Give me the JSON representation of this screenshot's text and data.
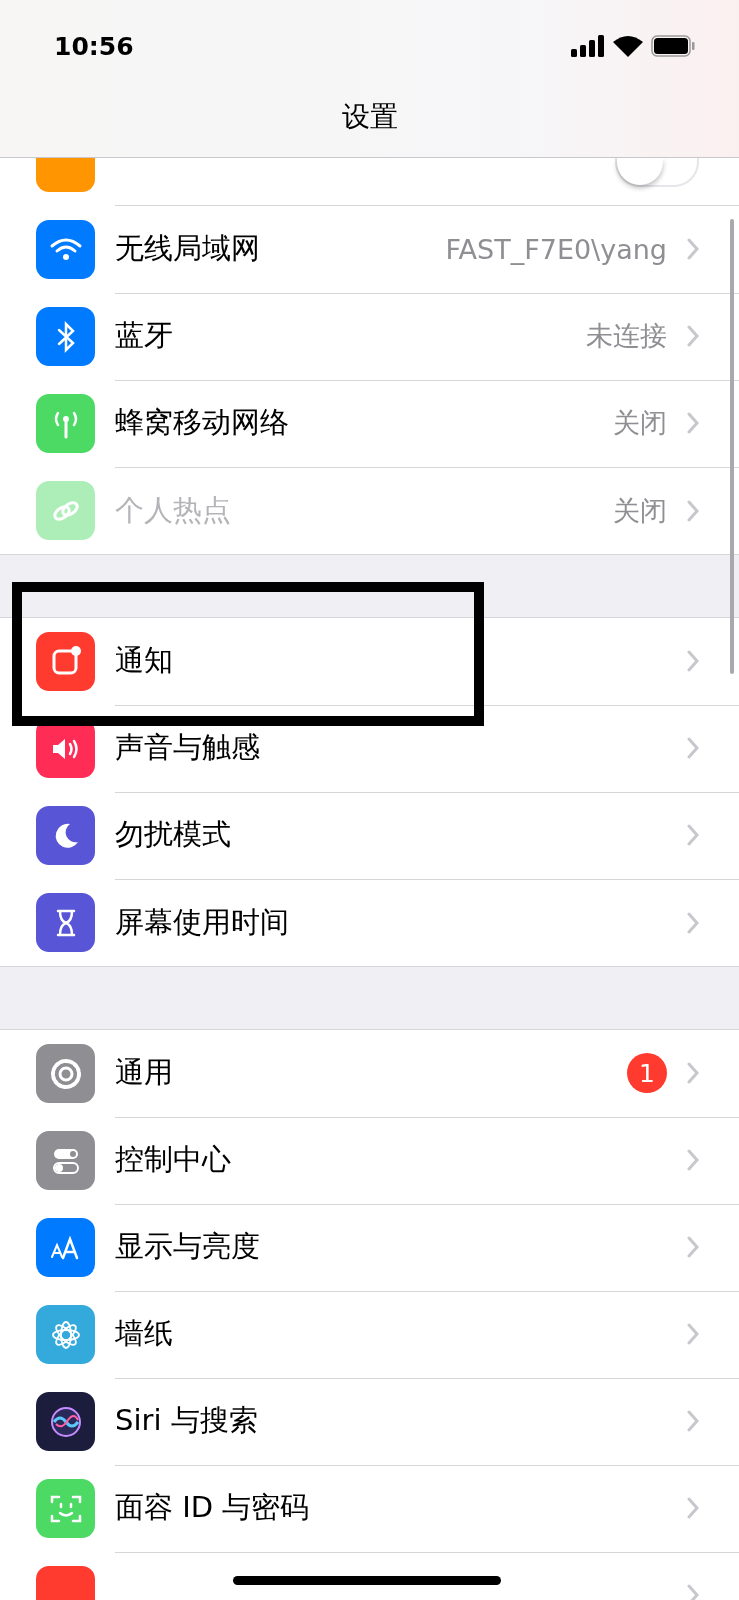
{
  "status_bar": {
    "time": "10:56"
  },
  "nav": {
    "title": "设置"
  },
  "groups": [
    {
      "rows": [
        {
          "kind": "toggle",
          "on": false,
          "disabled": false,
          "clipped_top": true
        },
        {
          "label": "无线局域网",
          "kind": "value",
          "value": "FAST_F7E0\\yang",
          "disabled": false
        },
        {
          "label": "蓝牙",
          "kind": "value",
          "value": "未连接",
          "disabled": false
        },
        {
          "label": "蜂窝移动网络",
          "kind": "value",
          "value": "关闭",
          "disabled": false
        },
        {
          "label": "个人热点",
          "kind": "value",
          "value": "关闭",
          "disabled": true
        }
      ]
    },
    {
      "rows": [
        {
          "label": "通知",
          "kind": "plain",
          "disabled": false,
          "highlighted": true
        },
        {
          "label": "声音与触感",
          "kind": "plain",
          "disabled": false
        },
        {
          "label": "勿扰模式",
          "kind": "plain",
          "disabled": false
        },
        {
          "label": "屏幕使用时间",
          "kind": "plain",
          "disabled": false
        }
      ]
    },
    {
      "rows": [
        {
          "label": "通用",
          "kind": "badge",
          "badge": "1",
          "disabled": false
        },
        {
          "label": "控制中心",
          "kind": "plain",
          "disabled": false
        },
        {
          "label": "显示与亮度",
          "kind": "plain",
          "disabled": false
        },
        {
          "label": "墙纸",
          "kind": "plain",
          "disabled": false
        },
        {
          "label": "Siri 与搜索",
          "kind": "plain",
          "disabled": false
        },
        {
          "label": "面容 ID 与密码",
          "kind": "plain",
          "disabled": false
        },
        {
          "kind": "plain",
          "disabled": false,
          "clipped_bottom": true
        }
      ]
    }
  ]
}
